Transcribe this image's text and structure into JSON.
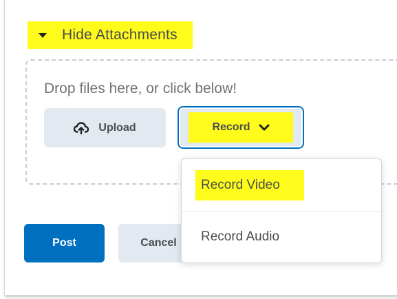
{
  "attachments": {
    "toggle_label": "Hide Attachments",
    "toggle_icon": "caret-down-icon",
    "drop_text": "Drop files here, or click below!",
    "upload_label": "Upload",
    "upload_icon": "cloud-upload-icon",
    "record_label": "Record",
    "record_icon": "chevron-down-icon"
  },
  "record_menu": {
    "items": [
      {
        "label": "Record Video"
      },
      {
        "label": "Record Audio"
      }
    ]
  },
  "actions": {
    "post_label": "Post",
    "cancel_label": "Cancel"
  },
  "colors": {
    "highlight": "#fffb1a",
    "primary": "#006fbf",
    "button_secondary": "#e3e9f1",
    "text": "#494c4e"
  }
}
